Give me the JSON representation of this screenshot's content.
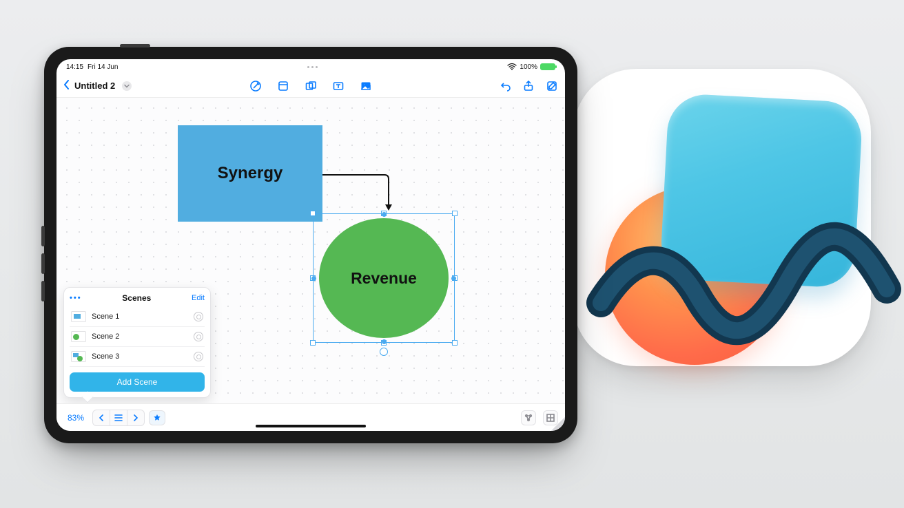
{
  "status": {
    "time": "14:15",
    "date": "Fri 14 Jun",
    "battery_pct": "100%"
  },
  "toolbar": {
    "title": "Untitled 2"
  },
  "canvas": {
    "rect_label": "Synergy",
    "circle_label": "Revenue"
  },
  "scenes": {
    "panel_title": "Scenes",
    "edit_label": "Edit",
    "items": [
      {
        "name": "Scene 1"
      },
      {
        "name": "Scene 2"
      },
      {
        "name": "Scene 3"
      }
    ],
    "add_label": "Add Scene"
  },
  "bottom": {
    "zoom": "83%"
  },
  "colors": {
    "accent": "#0a7cff",
    "rect": "#51ade0",
    "circle": "#55b853",
    "add_btn": "#31b4e9"
  },
  "app_icon": {
    "name": "freeform-app-icon"
  }
}
